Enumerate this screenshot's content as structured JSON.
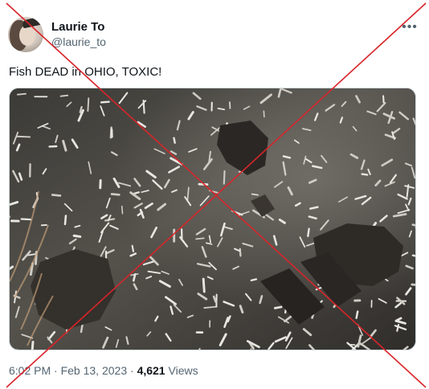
{
  "author": {
    "display_name": "Laurie To",
    "handle": "@laurie_to"
  },
  "tweet": {
    "text": "Fish DEAD in OHIO, TOXIC!",
    "time": "6:02 PM",
    "separator": " · ",
    "date": "Feb 13, 2023",
    "views_count": "4,621",
    "views_label": " Views"
  },
  "icons": {
    "more": "more-horizontal-icon"
  },
  "overlay": {
    "cross_color": "#d9252a"
  },
  "colors": {
    "text_primary": "#0f1419",
    "text_secondary": "#536471",
    "border": "#cfd9de"
  }
}
